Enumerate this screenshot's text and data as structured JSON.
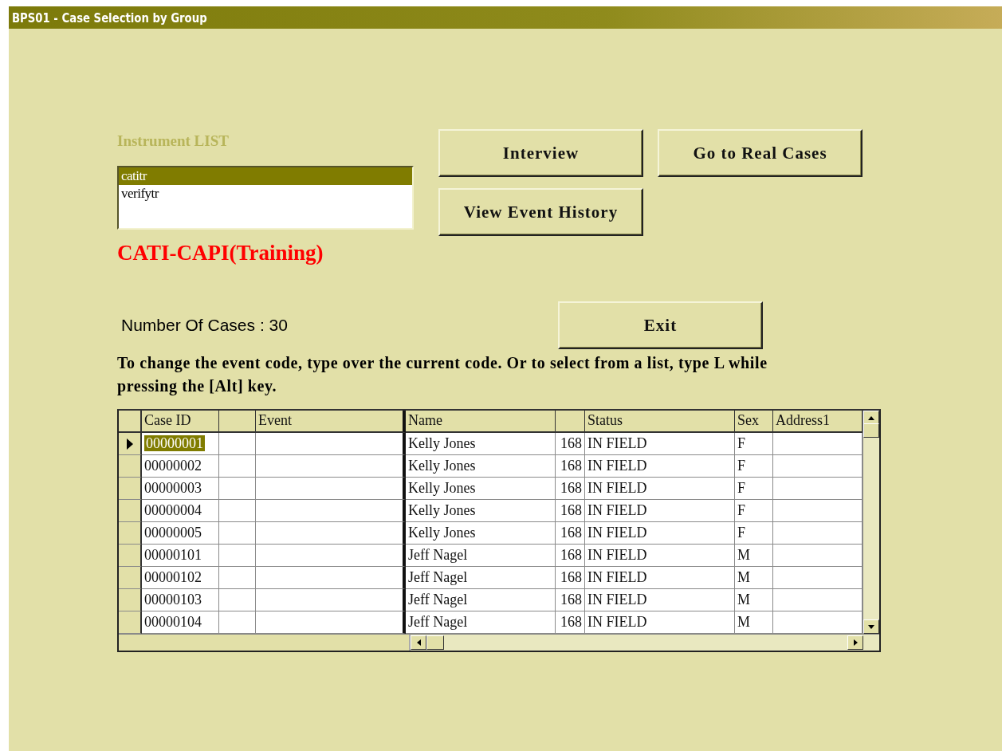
{
  "window": {
    "title": "BPS01 - Case Selection by Group"
  },
  "instrument_list": {
    "label": "Instrument LIST",
    "items": [
      {
        "label": "catitr",
        "selected": true
      },
      {
        "label": "verifytr",
        "selected": false
      }
    ]
  },
  "buttons": [
    {
      "label": "Interview"
    },
    {
      "label": "Go to Real Cases"
    },
    {
      "label": "View Event History"
    },
    {
      "label": "Exit"
    }
  ],
  "mode_label": "CATI-CAPI(Training)",
  "case_count": "Number Of Cases : 30",
  "instructions": "To change the event code, type over the current code. Or to select from a list, type L while pressing the [Alt] key.",
  "table": {
    "columns": [
      "Case ID",
      null,
      "Event",
      "Name",
      null,
      "Status",
      "Sex",
      "Address1"
    ],
    "rows": [
      {
        "selected": true,
        "cells": [
          "00000001",
          null,
          null,
          "Kelly Jones",
          "168",
          "IN FIELD",
          "F",
          null
        ]
      },
      {
        "selected": false,
        "cells": [
          "00000002",
          null,
          null,
          "Kelly Jones",
          "168",
          "IN FIELD",
          "F",
          null
        ]
      },
      {
        "selected": false,
        "cells": [
          "00000003",
          null,
          null,
          "Kelly Jones",
          "168",
          "IN FIELD",
          "F",
          null
        ]
      },
      {
        "selected": false,
        "cells": [
          "00000004",
          null,
          null,
          "Kelly Jones",
          "168",
          "IN FIELD",
          "F",
          null
        ]
      },
      {
        "selected": false,
        "cells": [
          "00000005",
          null,
          null,
          "Kelly Jones",
          "168",
          "IN FIELD",
          "F",
          null
        ]
      },
      {
        "selected": false,
        "cells": [
          "00000101",
          null,
          null,
          "Jeff Nagel",
          "168",
          "IN FIELD",
          "M",
          null
        ]
      },
      {
        "selected": false,
        "cells": [
          "00000102",
          null,
          null,
          "Jeff Nagel",
          "168",
          "IN FIELD",
          "M",
          null
        ]
      },
      {
        "selected": false,
        "cells": [
          "00000103",
          null,
          null,
          "Jeff Nagel",
          "168",
          "IN FIELD",
          "M",
          null
        ]
      },
      {
        "selected": false,
        "cells": [
          "00000104",
          null,
          null,
          "Jeff Nagel",
          "168",
          "IN FIELD",
          "M",
          null
        ]
      }
    ]
  }
}
